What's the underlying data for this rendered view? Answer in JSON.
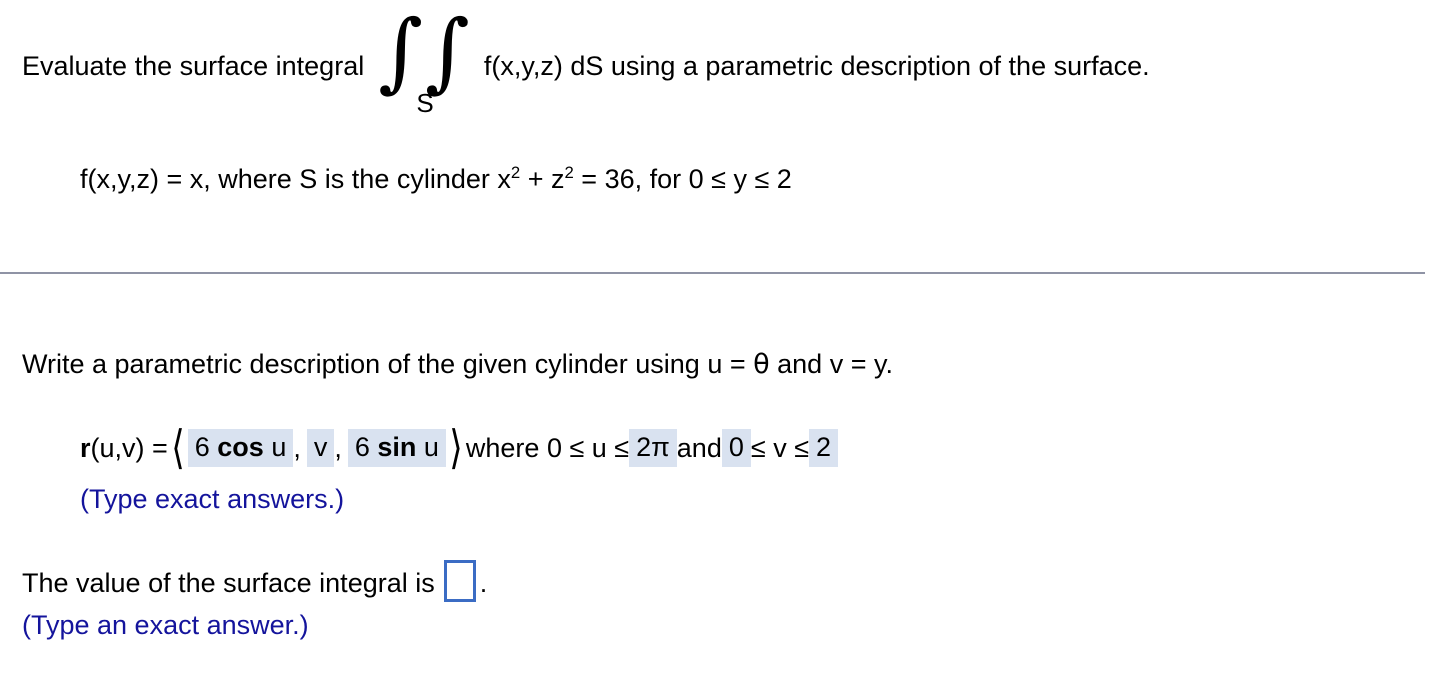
{
  "problem": {
    "intro_before_integral": "Evaluate the surface integral",
    "integral_symbol": "∫∫",
    "integral_subscript": "S",
    "intro_after_integral": "f(x,y,z) dS using a parametric description of the surface.",
    "function_line": {
      "full_text": "f(x,y,z) = x, where S is the cylinder x2 + z2 = 36, for 0 ≤ y ≤ 2",
      "definition": "f(x,y,z) = x, where S is the cylinder x",
      "exponent_1": "2",
      "middle": " + z",
      "exponent_2": "2",
      "tail": " = 36, for 0 ≤ y ≤ 2"
    }
  },
  "work": {
    "prompt_part_1": "Write a parametric description of the given cylinder using u = ",
    "theta_symbol": "θ",
    "prompt_part_2": " and v = y.",
    "parametric": {
      "r_bold": "r",
      "r_args": "(u,v) = ",
      "open_angle": "⟨",
      "component_x": "6 cos u",
      "component_x_coefficient": "6",
      "component_x_function": "cos",
      "component_x_variable": "u",
      "comma_1": ",",
      "component_y": "v",
      "comma_2": ",",
      "component_z": "6 sin u",
      "component_z_coefficient": "6",
      "component_z_function": "sin",
      "component_z_variable": "u",
      "close_angle": "⟩",
      "where_text": " where 0 ≤ u ≤ ",
      "u_upper_bound": "2π",
      "and_text": " and ",
      "v_lower_bound": "0",
      "v_middle_text": " ≤ v ≤ ",
      "v_upper_bound": "2"
    },
    "note_exact_answers": "(Type exact answers.)",
    "final_prompt": "The value of the surface integral is",
    "final_answer_value": "",
    "final_period": ".",
    "note_exact_answer": "(Type an exact answer.)"
  },
  "colors": {
    "text": "#000000",
    "blue_note": "#14149c",
    "fill_highlight": "#d9e2f0",
    "input_border": "#3b6cc4",
    "divider": "#8f93a5",
    "background": "#ffffff"
  }
}
